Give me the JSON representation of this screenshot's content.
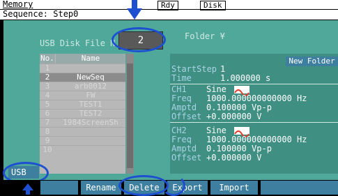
{
  "status": {
    "mode": "Memory",
    "sequence": "Sequence: Step0",
    "rdy": "Rdy",
    "disk": "Disk"
  },
  "panel": {
    "title": "USB Disk File N",
    "file_number": "2",
    "folder": "Folder ¥",
    "new_folder": "New Folder"
  },
  "file_list": {
    "col_no": "No.",
    "col_name": "Name",
    "rows": [
      {
        "no": "1",
        "name": ""
      },
      {
        "no": "2",
        "name": "NewSeq"
      },
      {
        "no": "3",
        "name": "arb0012"
      },
      {
        "no": "4",
        "name": "FW"
      },
      {
        "no": "5",
        "name": "TEST1"
      },
      {
        "no": "6",
        "name": "TEST2"
      },
      {
        "no": "7",
        "name": "1984ScreenSh"
      },
      {
        "no": "8",
        "name": ""
      },
      {
        "no": "9",
        "name": ""
      },
      {
        "no": "10",
        "name": ""
      }
    ]
  },
  "detail": {
    "start_step_label": "StartStep",
    "start_step_value": "1",
    "time_label": "Time",
    "time_value": "1.000000 s",
    "ch1": {
      "label": "CH1",
      "wave": "Sine",
      "freq_label": "Freq",
      "freq": "1000.000000000000 Hz",
      "amptd_label": "Amptd",
      "amptd": "0.100000 Vp-p",
      "offset_label": "Offset",
      "offset": "+0.000000 V"
    },
    "ch2": {
      "label": "CH2",
      "wave": "Sine",
      "freq_label": "Freq",
      "freq": "1000.000000000000 Hz",
      "amptd_label": "Amptd",
      "amptd": "0.100000 Vp-p",
      "offset_label": "Offset",
      "offset": "+0.000000 V"
    }
  },
  "softkeys": {
    "usb": "USB",
    "rename": "Rename",
    "delete": "Delete",
    "export": "Export",
    "import": "Import"
  },
  "colors": {
    "accent": "#1d4fd0",
    "panel": "#4fa89a",
    "softkey": "#3e7fa0",
    "wave": "#e23a2a"
  }
}
